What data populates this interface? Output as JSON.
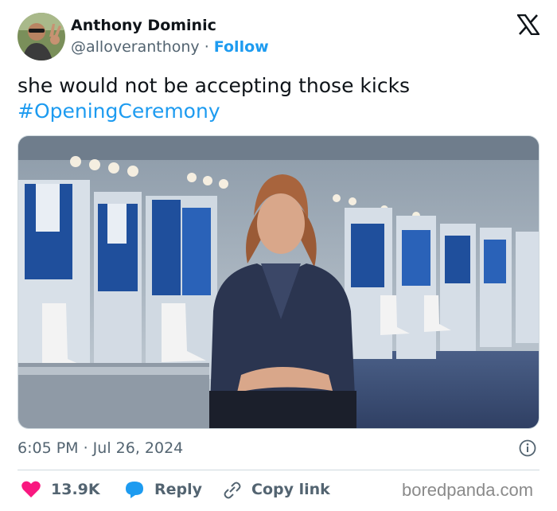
{
  "author": {
    "name": "Anthony Dominic",
    "handle": "@alloveranthony",
    "separator": " · ",
    "follow_label": "Follow"
  },
  "tweet": {
    "text": "she would not be accepting those kicks",
    "hashtag": "#OpeningCeremony"
  },
  "meta": {
    "timestamp": "6:05 PM · Jul 26, 2024"
  },
  "actions": {
    "likes_count": "13.9K",
    "reply_label": "Reply",
    "copy_link_label": "Copy link"
  },
  "watermark": "boredpanda.com",
  "icons": {
    "platform": "x-logo-icon",
    "info": "info-icon",
    "like": "heart-icon",
    "reply": "speech-bubble-icon",
    "copy": "link-icon"
  },
  "colors": {
    "accent": "#1d9bf0",
    "like": "#f91880",
    "text": "#0f1419",
    "muted": "#536471"
  }
}
